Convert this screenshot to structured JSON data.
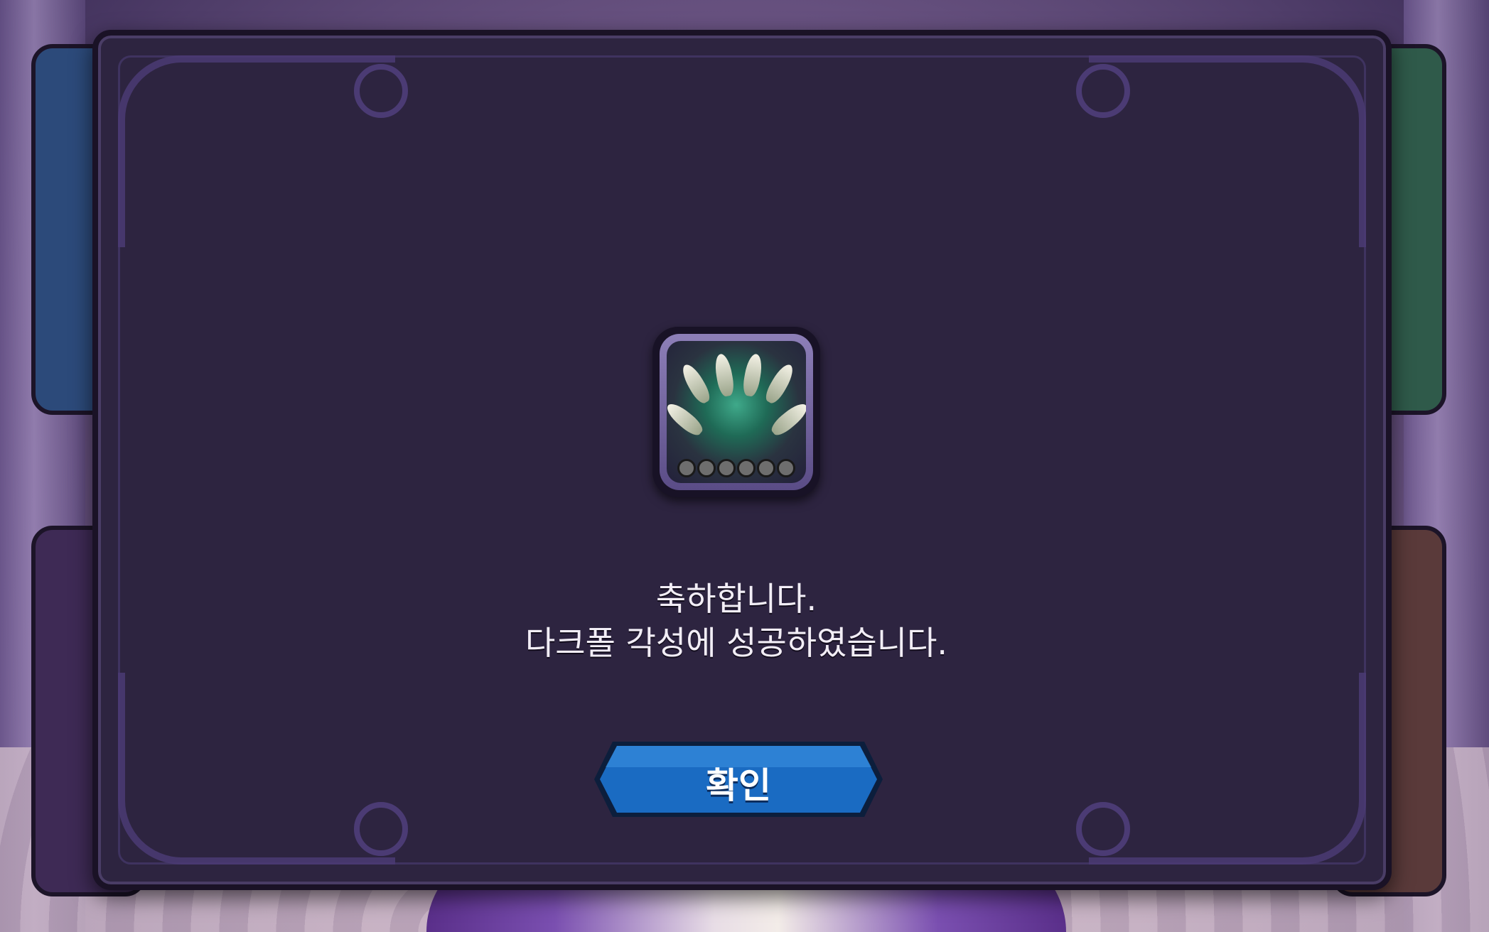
{
  "dialog": {
    "message_line1": "축하합니다.",
    "message_line2": "다크폴 각성에 성공하였습니다.",
    "confirm_label": "확인"
  },
  "item": {
    "icon": "dark-fall-character-icon",
    "star_count": 6,
    "filled_stars": 0
  },
  "colors": {
    "dialog_bg": "#2d2440",
    "button_blue": "#1a6bc2",
    "text": "#f2eef6"
  }
}
